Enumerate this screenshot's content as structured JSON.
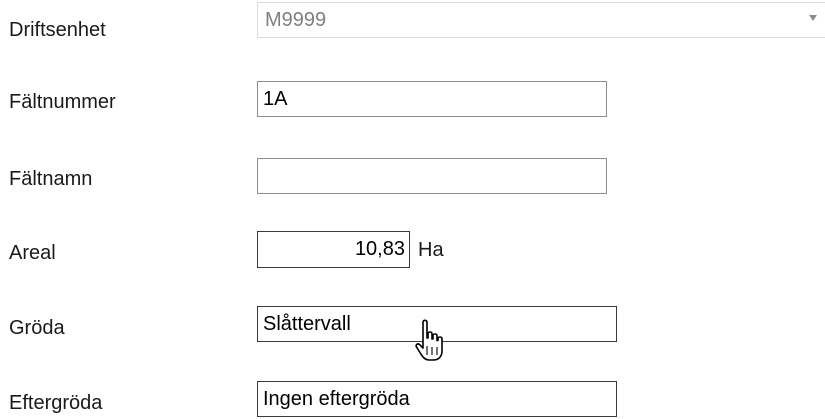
{
  "form": {
    "driftsenhet": {
      "label": "Driftsenhet",
      "value": "M9999"
    },
    "faltnummer": {
      "label": "Fältnummer",
      "value": "1A"
    },
    "faltnamn": {
      "label": "Fältnamn",
      "value": ""
    },
    "areal": {
      "label": "Areal",
      "value": "10,83",
      "unit": "Ha"
    },
    "groda": {
      "label": "Gröda",
      "value": "Slåttervall"
    },
    "eftergroda": {
      "label": "Eftergröda",
      "value": "Ingen eftergröda"
    }
  },
  "cursor": {
    "type": "hand-pointer-icon"
  },
  "colors": {
    "border_light": "#dcdcdc",
    "border_default": "#8f8f8f",
    "border_dark": "#3a3a3a",
    "select_text": "#7f7f7f"
  }
}
